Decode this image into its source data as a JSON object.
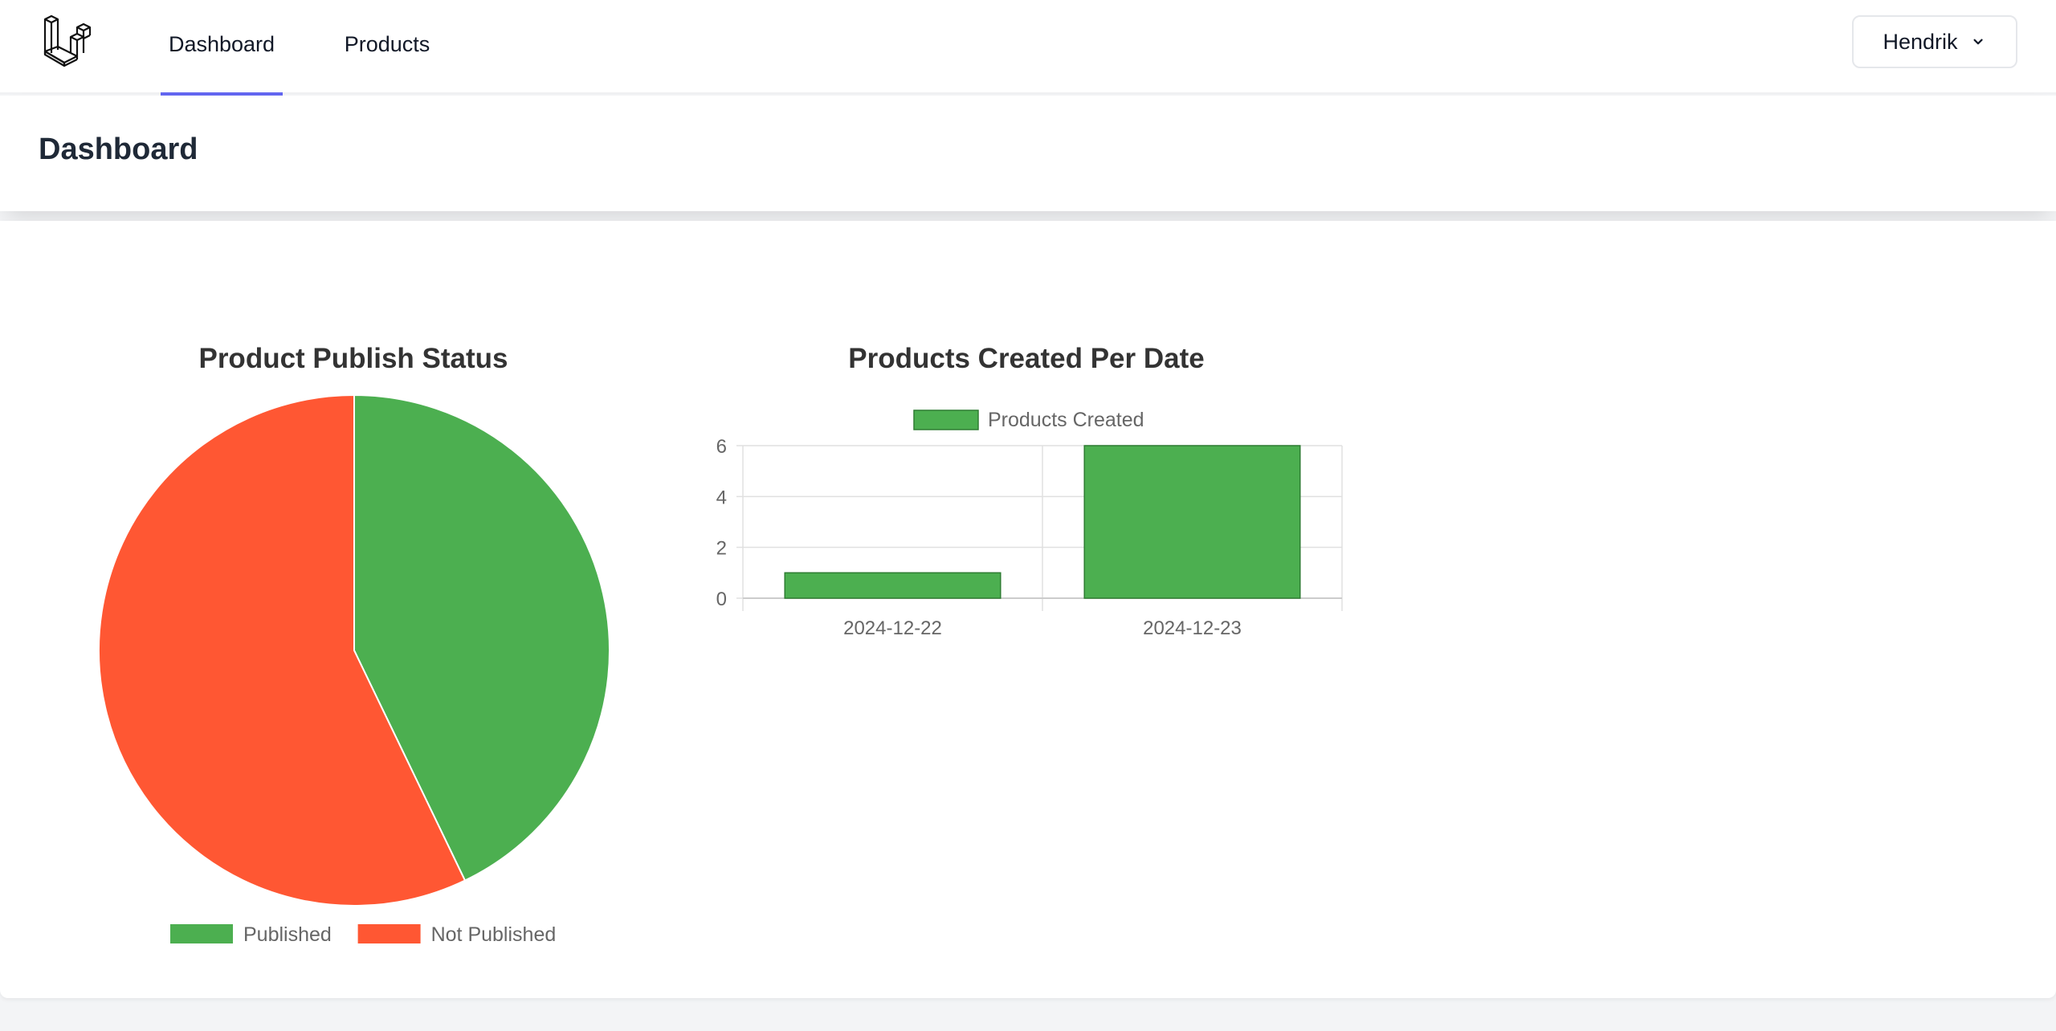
{
  "nav": {
    "links": [
      {
        "label": "Dashboard",
        "active": true
      },
      {
        "label": "Products",
        "active": false
      }
    ],
    "user_name": "Hendrik",
    "accent_color": "#6366f1"
  },
  "header": {
    "title": "Dashboard"
  },
  "chart_data": [
    {
      "type": "pie",
      "title": "Product Publish Status",
      "categories": [
        "Published",
        "Not Published"
      ],
      "values": [
        3,
        4
      ],
      "colors": [
        "#4caf50",
        "#ff5733"
      ],
      "legend_position": "bottom"
    },
    {
      "type": "bar",
      "title": "Products Created Per Date",
      "categories": [
        "2024-12-22",
        "2024-12-23"
      ],
      "series": [
        {
          "name": "Products Created",
          "values": [
            1,
            6
          ],
          "color": "#4caf50"
        }
      ],
      "ylim": [
        0,
        6
      ],
      "yticks": [
        0,
        2,
        4,
        6
      ],
      "grid": true,
      "legend_position": "top"
    }
  ]
}
